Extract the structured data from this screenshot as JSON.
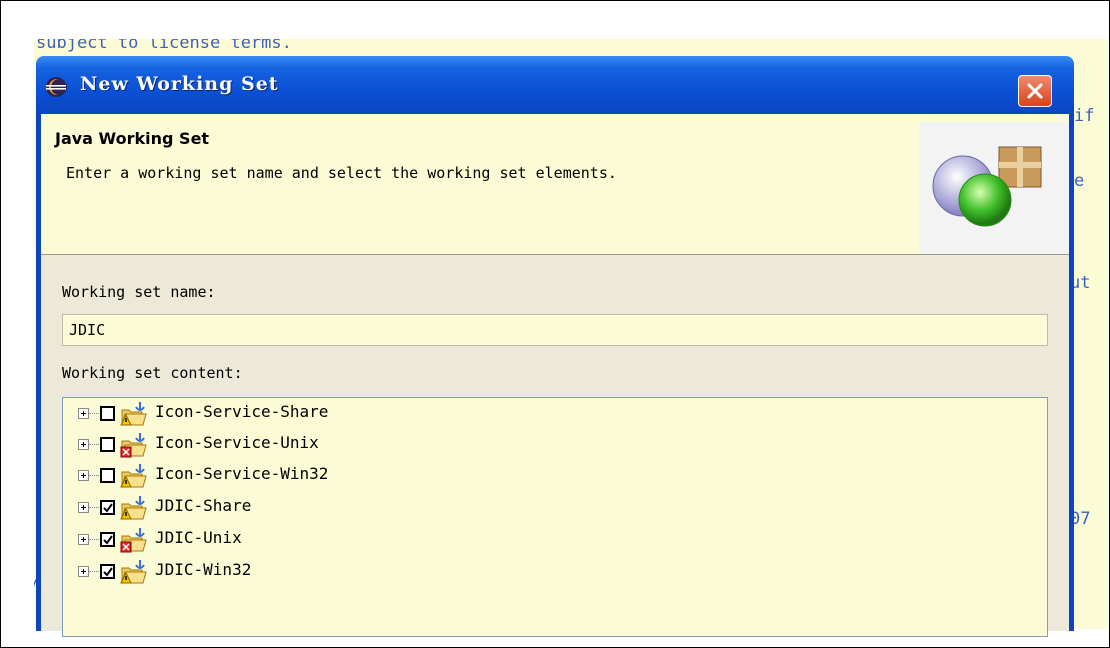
{
  "editor": {
    "lines": [
      {
        "text": "subject to license terms."
      },
      {
        "text": "if"
      },
      {
        "text": "e"
      },
      {
        "text": "ut"
      },
      {
        "text": "07"
      },
      {
        "text": "/"
      }
    ]
  },
  "dialog": {
    "title": "New Working Set",
    "header": {
      "title": "Java Working Set",
      "description": "Enter a working set name and select the working set elements."
    },
    "name_label": "Working set name:",
    "name_value": "JDIC",
    "content_label": "Working set content:",
    "tree_items": [
      {
        "label": "Icon-Service-Share",
        "checked": false,
        "error": false
      },
      {
        "label": "Icon-Service-Unix",
        "checked": false,
        "error": true
      },
      {
        "label": "Icon-Service-Win32",
        "checked": false,
        "error": false
      },
      {
        "label": "JDIC-Share",
        "checked": true,
        "error": false
      },
      {
        "label": "JDIC-Unix",
        "checked": true,
        "error": true
      },
      {
        "label": "JDIC-Win32",
        "checked": true,
        "error": false
      }
    ]
  },
  "colors": {
    "titlebar": "#0b45bf",
    "dialog_bg": "#ece9d8",
    "editor_bg": "#fbfbd6",
    "comment_text": "#3f5fbf",
    "close_button": "#d9431c"
  }
}
